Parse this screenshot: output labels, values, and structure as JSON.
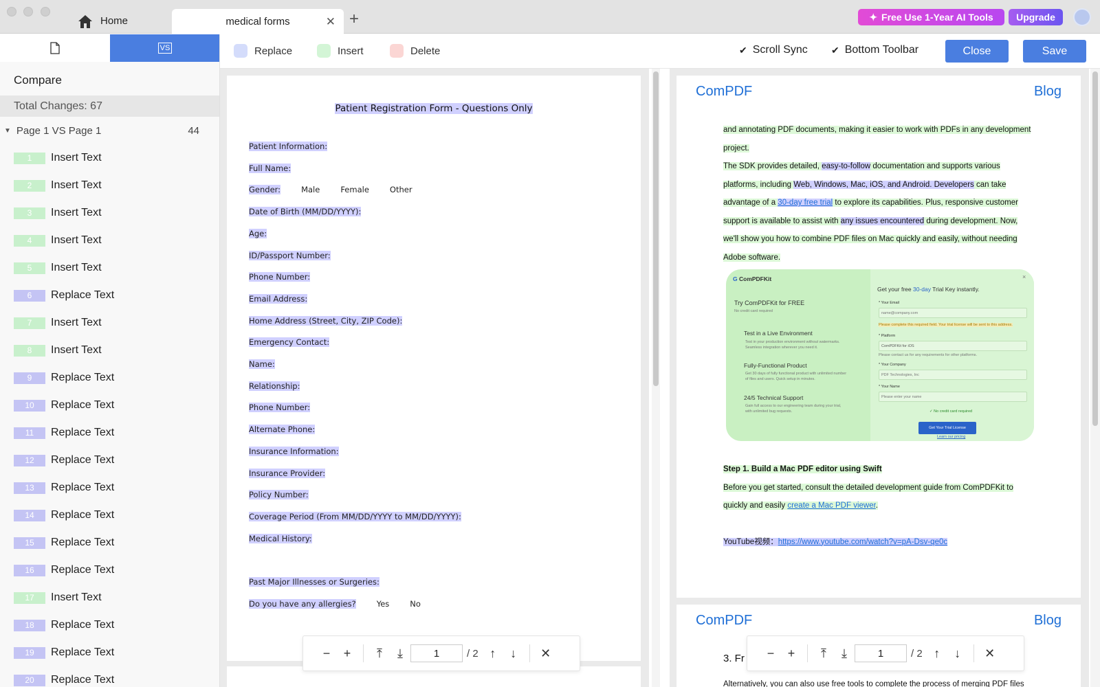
{
  "titlebar": {
    "tabs": [
      {
        "label": "Home"
      },
      {
        "label": "medical forms"
      }
    ],
    "promo_label": "Free Use 1-Year AI Tools",
    "upgrade_label": "Upgrade"
  },
  "sidebar": {
    "vs_label": "VS",
    "compare_title": "Compare",
    "total_label": "Total Changes: 67",
    "group_label": "Page 1 VS Page 1",
    "group_count": "44",
    "items": [
      {
        "num": "1",
        "label": "Insert Text",
        "type": "insert"
      },
      {
        "num": "2",
        "label": "Insert Text",
        "type": "insert"
      },
      {
        "num": "3",
        "label": "Insert Text",
        "type": "insert"
      },
      {
        "num": "4",
        "label": "Insert Text",
        "type": "insert"
      },
      {
        "num": "5",
        "label": "Insert Text",
        "type": "insert"
      },
      {
        "num": "6",
        "label": "Replace Text",
        "type": "replace"
      },
      {
        "num": "7",
        "label": "Insert Text",
        "type": "insert"
      },
      {
        "num": "8",
        "label": "Insert Text",
        "type": "insert"
      },
      {
        "num": "9",
        "label": "Replace Text",
        "type": "replace"
      },
      {
        "num": "10",
        "label": "Replace Text",
        "type": "replace"
      },
      {
        "num": "11",
        "label": "Replace Text",
        "type": "replace"
      },
      {
        "num": "12",
        "label": "Replace Text",
        "type": "replace"
      },
      {
        "num": "13",
        "label": "Replace Text",
        "type": "replace"
      },
      {
        "num": "14",
        "label": "Replace Text",
        "type": "replace"
      },
      {
        "num": "15",
        "label": "Replace Text",
        "type": "replace"
      },
      {
        "num": "16",
        "label": "Replace Text",
        "type": "replace"
      },
      {
        "num": "17",
        "label": "Insert Text",
        "type": "insert"
      },
      {
        "num": "18",
        "label": "Replace Text",
        "type": "replace"
      },
      {
        "num": "19",
        "label": "Replace Text",
        "type": "replace"
      },
      {
        "num": "20",
        "label": "Replace Text",
        "type": "replace"
      }
    ]
  },
  "toolbar": {
    "legend": [
      {
        "label": "Replace",
        "color": "#d4dcfb"
      },
      {
        "label": "Insert",
        "color": "#d3f5d6"
      },
      {
        "label": "Delete",
        "color": "#fbd6d4"
      }
    ],
    "scroll_sync_label": "Scroll Sync",
    "bottom_toolbar_label": "Bottom Toolbar",
    "close_label": "Close",
    "save_label": "Save"
  },
  "left_doc": {
    "title": "Patient Registration Form - Questions Only",
    "questions": [
      "Patient Information:",
      "Full Name:",
      "Gender:",
      "Date of Birth (MM/DD/YYYY):",
      "Age:",
      "ID/Passport Number:",
      "Phone Number:",
      "Email Address:",
      "Home Address (Street, City, ZIP Code):",
      "Emergency Contact:",
      "Name:",
      "Relationship:",
      "Phone Number:",
      "Alternate Phone:",
      "Insurance Information:",
      "Insurance Provider:",
      "Policy Number:",
      "Coverage Period (From MM/DD/YYYY to MM/DD/YYYY):",
      "Medical History:",
      "",
      "Past Major Illnesses or Surgeries:",
      "Do you have any allergies?"
    ],
    "gender_options": [
      "Male",
      "Female",
      "Other"
    ],
    "allergy_options": [
      "Yes",
      "No"
    ]
  },
  "right_doc": {
    "brand": "ComPDF",
    "blog": "Blog",
    "p1": "and annotating PDF documents, making it easier to work with PDFs in any development project.",
    "p2a": "The SDK provides detailed, ",
    "p2b": "easy-to-follow",
    "p2c": " documentation and supports various platforms, including ",
    "p2d": "Web, Windows, Mac, iOS, and Android.",
    "p2e": " Developers",
    "p2f": " can take advantage of a ",
    "p2link": "30-day free trial",
    "p2g": " to explore its capabilities. Plus, responsive customer support is available to assist with ",
    "p2h": "any issues encountered",
    "p2i": " during development. Now, we'll show you how to combine PDF files on Mac quickly and easily, without needing Adobe software.",
    "step_title": "Step 1. Build a Mac PDF editor using Swift",
    "p3a": "Before you get started, consult the detailed development guide from ComPDFKit to quickly and easily ",
    "p3link": "create a Mac PDF viewer",
    "p3b": ".",
    "yt_label": "YouTube视频：",
    "yt_link": "https://www.youtube.com/watch?v=pA-Dsv-qe0c",
    "page2_snippet": "3. Fr",
    "page2_line": "Alternatively, you can also use free tools to complete the process of merging PDF files",
    "screenshot": {
      "logo": "ComPDFKit",
      "headline": "Try ComPDFKit for FREE",
      "sub": "No credit card required",
      "f1": "Test in a Live Environment",
      "f1d": "Test in your production environment without watermarks. Seamless integration wherever you need it.",
      "f2": "Fully-Functional Product",
      "f2d": "Get 30 days of fully functional product with unlimited number of files and users. Quick setup in minutes.",
      "f3": "24/5 Technical Support",
      "f3d": "Gain full access to our engineering team during your trial, with unlimited bug requests.",
      "r_title_a": "Get your free ",
      "r_title_b": "30-day",
      "r_title_c": " Trial Key instantly.",
      "email_label": "* Your Email",
      "email_ph": "name@company.com",
      "warn": "Please complete this required field. Your trial license will be sent to this address.",
      "platform_label": "* Platform",
      "platform_val": "ComPDFKit for iOS",
      "platform_hint": "Please contact us for any requirements for other platforms.",
      "company_label": "* Your Company",
      "company_ph": "PDF Technologies, Inc",
      "name_label": "* Your Name",
      "name_ph": "Please enter your name",
      "nocc": "✓ No credit card required",
      "btn": "Get Your Trial License",
      "learn": "Learn our pricing"
    }
  },
  "stepbar": {
    "page": "1",
    "total": "/ 2"
  },
  "stepbar2": {
    "page": "1",
    "total": "/ 2"
  }
}
